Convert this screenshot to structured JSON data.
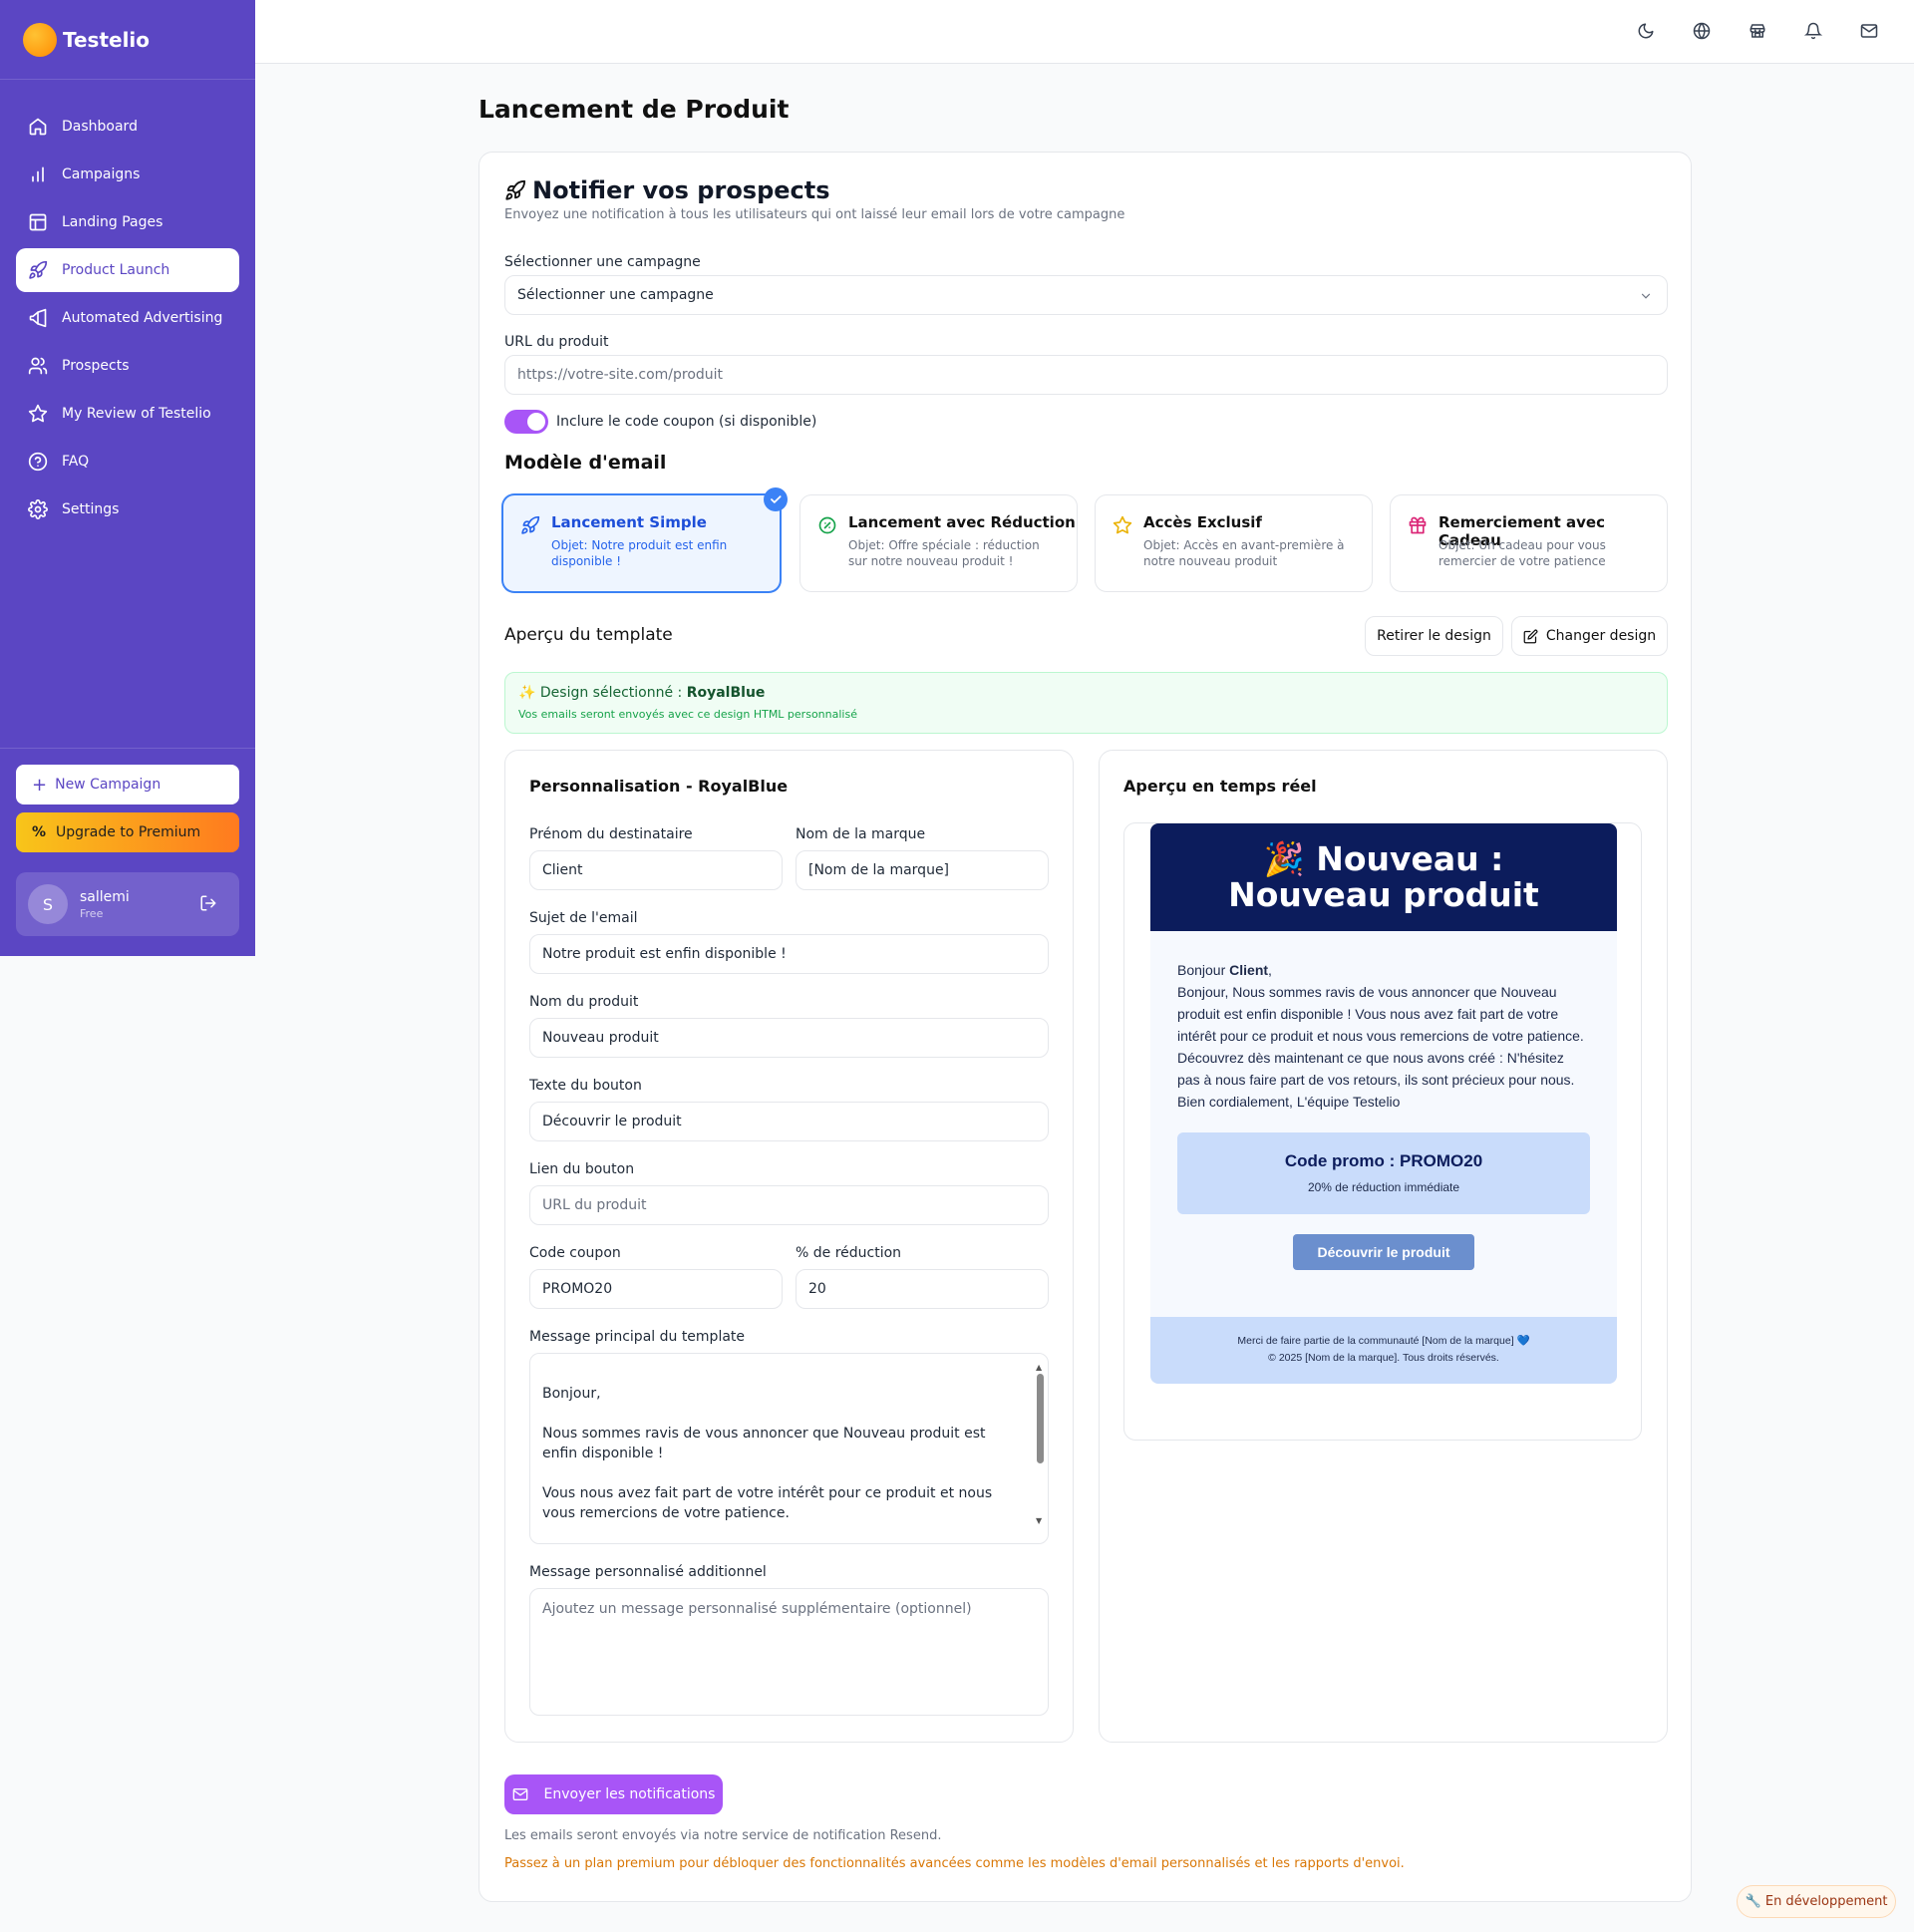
{
  "app": {
    "name": "Testelio"
  },
  "sidebar": {
    "items": [
      {
        "label": "Dashboard",
        "icon": "home-icon"
      },
      {
        "label": "Campaigns",
        "icon": "bar-chart-icon"
      },
      {
        "label": "Landing Pages",
        "icon": "layout-icon"
      },
      {
        "label": "Product Launch",
        "icon": "rocket-icon",
        "active": true
      },
      {
        "label": "Automated Advertising",
        "icon": "megaphone-icon"
      },
      {
        "label": "Prospects",
        "icon": "users-icon"
      },
      {
        "label": "My Review of Testelio",
        "icon": "star-icon"
      },
      {
        "label": "FAQ",
        "icon": "help-circle-icon"
      },
      {
        "label": "Settings",
        "icon": "gear-icon"
      }
    ],
    "new_campaign": "New Campaign",
    "upgrade": "Upgrade to Premium",
    "user": {
      "initial": "S",
      "name": "sallemi",
      "plan": "Free"
    }
  },
  "topbar": {
    "icons": [
      "moon-icon",
      "globe-icon",
      "store-icon",
      "bell-icon",
      "mail-icon"
    ]
  },
  "page": {
    "title": "Lancement de Produit"
  },
  "notify": {
    "title": "Notifier vos prospects",
    "subtitle": "Envoyez une notification à tous les utilisateurs qui ont laissé leur email lors de votre campagne",
    "campaign_label": "Sélectionner une campagne",
    "campaign_value": "Sélectionner une campagne",
    "url_label": "URL du produit",
    "url_placeholder": "https://votre-site.com/produit",
    "coupon_toggle": "Inclure le code coupon (si disponible)",
    "coupon_toggle_on": true
  },
  "templates": {
    "title": "Modèle d'email",
    "items": [
      {
        "name": "Lancement Simple",
        "subject": "Objet: Notre produit est enfin disponible !",
        "icon": "rocket-icon",
        "selected": true
      },
      {
        "name": "Lancement avec Réduction",
        "subject": "Objet: Offre spéciale : réduction sur notre nouveau produit !",
        "icon": "discount-badge-icon"
      },
      {
        "name": "Accès Exclusif",
        "subject": "Objet: Accès en avant-première à notre nouveau produit",
        "icon": "star-icon"
      },
      {
        "name": "Remerciement avec Cadeau",
        "subject": "Objet: Un cadeau pour vous remercier de votre patience",
        "icon": "gift-icon"
      }
    ]
  },
  "preview_section": {
    "title": "Aperçu du template",
    "remove_design": "Retirer le design",
    "change_design": "Changer design",
    "design_prefix": "✨ Design sélectionné : ",
    "design_name": "RoyalBlue",
    "design_note": "Vos emails seront envoyés avec ce design HTML personnalisé"
  },
  "custom": {
    "title": "Personnalisation - RoyalBlue",
    "first_name_label": "Prénom du destinataire",
    "first_name": "Client",
    "brand_label": "Nom de la marque",
    "brand": "[Nom de la marque]",
    "subject_label": "Sujet de l'email",
    "subject": "Notre produit est enfin disponible !",
    "product_label": "Nom du produit",
    "product": "Nouveau produit",
    "button_text_label": "Texte du bouton",
    "button_text": "Découvrir le produit",
    "button_link_label": "Lien du bouton",
    "button_link_placeholder": "URL du produit",
    "coupon_label": "Code coupon",
    "coupon": "PROMO20",
    "discount_label": "% de réduction",
    "discount": "20",
    "main_message_label": "Message principal du template",
    "main_message": "Bonjour,\n\nNous sommes ravis de vous annoncer que Nouveau produit est enfin disponible !\n\nVous nous avez fait part de votre intérêt pour ce produit et nous vous remercions de votre patience.\n\nDécouvrez dès maintenant ce que nous avons créé :",
    "extra_message_label": "Message personnalisé additionnel",
    "extra_message_placeholder": "Ajoutez un message personnalisé supplémentaire (optionnel)"
  },
  "live_preview": {
    "title": "Aperçu en temps réel",
    "header": "🎉 Nouveau : Nouveau produit",
    "greeting_prefix": "Bonjour ",
    "greeting_name": "Client",
    "greeting_suffix": ",",
    "body": "Bonjour, Nous sommes ravis de vous annoncer que Nouveau produit est enfin disponible ! Vous nous avez fait part de votre intérêt pour ce produit et nous vous remercions de votre patience. Découvrez dès maintenant ce que nous avons créé : N'hésitez pas à nous faire part de vos retours, ils sont précieux pour nous. Bien cordialement, L'équipe Testelio",
    "promo_title": "Code promo : PROMO20",
    "promo_sub": "20% de réduction immédiate",
    "button": "Découvrir le produit",
    "footer_line1": "Merci de faire partie de la communauté [Nom de la marque] 💙",
    "footer_line2": "© 2025 [Nom de la marque]. Tous droits réservés."
  },
  "actions": {
    "send": "Envoyer les notifications",
    "note": "Les emails seront envoyés via notre service de notification Resend.",
    "premium_note": "Passez à un plan premium pour débloquer des fonctionnalités avancées comme les modèles d'email personnalisés et les rapports d'envoi."
  },
  "badge": {
    "dev": "🔧 En développement"
  },
  "colors": {
    "sidebar": "#5b46c3",
    "accent_purple": "#a855f7",
    "selected_blue": "#3b82f6",
    "email_header": "#0c1c5c",
    "premium_note": "#d97706"
  }
}
